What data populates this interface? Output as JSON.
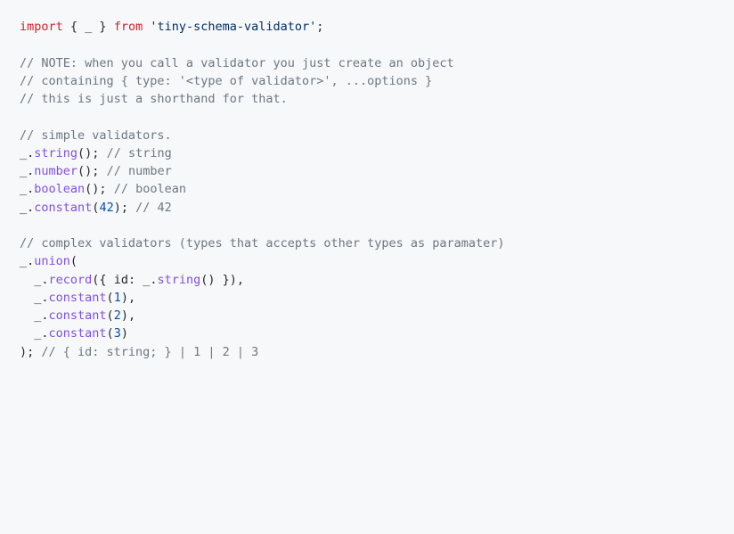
{
  "code": {
    "lines": [
      [
        {
          "cls": "kw",
          "t": "import"
        },
        {
          "cls": "pl",
          "t": " { _ } "
        },
        {
          "cls": "kw",
          "t": "from"
        },
        {
          "cls": "pl",
          "t": " "
        },
        {
          "cls": "str",
          "t": "'tiny-schema-validator'"
        },
        {
          "cls": "pl",
          "t": ";"
        }
      ],
      [],
      [
        {
          "cls": "cmt",
          "t": "// NOTE: when you call a validator you just create an object"
        }
      ],
      [
        {
          "cls": "cmt",
          "t": "// containing { type: '<type of validator>', ...options }"
        }
      ],
      [
        {
          "cls": "cmt",
          "t": "// this is just a shorthand for that."
        }
      ],
      [],
      [
        {
          "cls": "cmt",
          "t": "// simple validators."
        }
      ],
      [
        {
          "cls": "pl",
          "t": "_."
        },
        {
          "cls": "fn",
          "t": "string"
        },
        {
          "cls": "pl",
          "t": "(); "
        },
        {
          "cls": "cmt",
          "t": "// string"
        }
      ],
      [
        {
          "cls": "pl",
          "t": "_."
        },
        {
          "cls": "fn",
          "t": "number"
        },
        {
          "cls": "pl",
          "t": "(); "
        },
        {
          "cls": "cmt",
          "t": "// number"
        }
      ],
      [
        {
          "cls": "pl",
          "t": "_."
        },
        {
          "cls": "fn",
          "t": "boolean"
        },
        {
          "cls": "pl",
          "t": "(); "
        },
        {
          "cls": "cmt",
          "t": "// boolean"
        }
      ],
      [
        {
          "cls": "pl",
          "t": "_."
        },
        {
          "cls": "fn",
          "t": "constant"
        },
        {
          "cls": "pl",
          "t": "("
        },
        {
          "cls": "num",
          "t": "42"
        },
        {
          "cls": "pl",
          "t": "); "
        },
        {
          "cls": "cmt",
          "t": "// 42"
        }
      ],
      [],
      [
        {
          "cls": "cmt",
          "t": "// complex validators (types that accepts other types as paramater)"
        }
      ],
      [
        {
          "cls": "pl",
          "t": "_."
        },
        {
          "cls": "fn",
          "t": "union"
        },
        {
          "cls": "pl",
          "t": "("
        }
      ],
      [
        {
          "cls": "pl",
          "t": "  _."
        },
        {
          "cls": "fn",
          "t": "record"
        },
        {
          "cls": "pl",
          "t": "({ "
        },
        {
          "cls": "prop",
          "t": "id"
        },
        {
          "cls": "pl",
          "t": ": _."
        },
        {
          "cls": "fn",
          "t": "string"
        },
        {
          "cls": "pl",
          "t": "() }),"
        }
      ],
      [
        {
          "cls": "pl",
          "t": "  _."
        },
        {
          "cls": "fn",
          "t": "constant"
        },
        {
          "cls": "pl",
          "t": "("
        },
        {
          "cls": "num",
          "t": "1"
        },
        {
          "cls": "pl",
          "t": "),"
        }
      ],
      [
        {
          "cls": "pl",
          "t": "  _."
        },
        {
          "cls": "fn",
          "t": "constant"
        },
        {
          "cls": "pl",
          "t": "("
        },
        {
          "cls": "num",
          "t": "2"
        },
        {
          "cls": "pl",
          "t": "),"
        }
      ],
      [
        {
          "cls": "pl",
          "t": "  _."
        },
        {
          "cls": "fn",
          "t": "constant"
        },
        {
          "cls": "pl",
          "t": "("
        },
        {
          "cls": "num",
          "t": "3"
        },
        {
          "cls": "pl",
          "t": ")"
        }
      ],
      [
        {
          "cls": "pl",
          "t": "); "
        },
        {
          "cls": "cmt",
          "t": "// { id: string; } | 1 | 2 | 3"
        }
      ]
    ]
  }
}
